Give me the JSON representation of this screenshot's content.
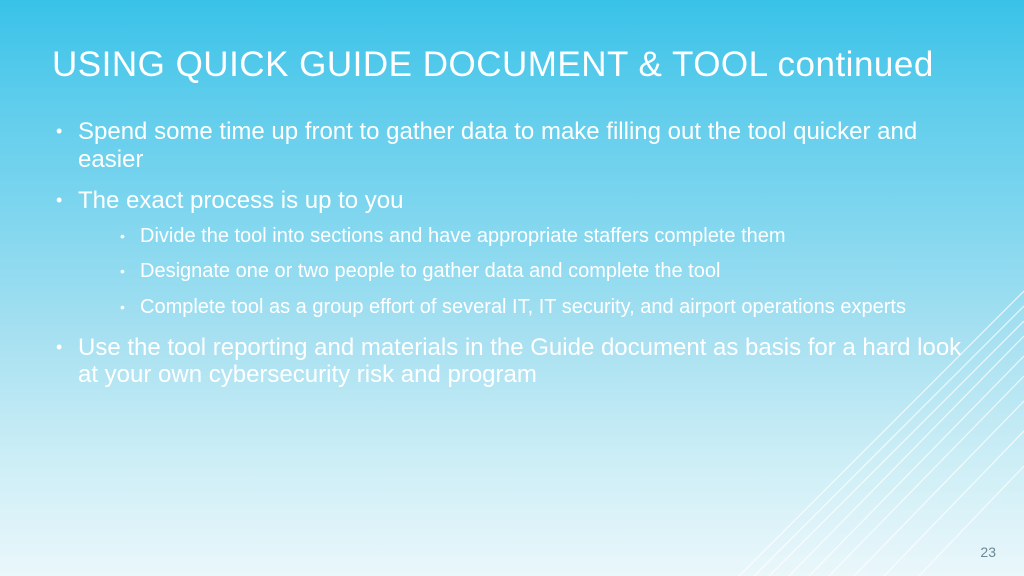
{
  "title": "USING QUICK GUIDE DOCUMENT & TOOL continued",
  "bullets": {
    "b1": "Spend some time up front to gather data to make filling out the tool quicker and easier",
    "b2": "The exact process is up to you",
    "sub1": "Divide the tool into sections and have appropriate staffers complete them",
    "sub2": "Designate one or two people to gather data and complete the tool",
    "sub3": "Complete tool as a group effort of several IT, IT security, and airport operations experts",
    "b3": "Use the tool reporting and materials in the Guide document as basis for a hard look at your own cybersecurity risk and program"
  },
  "page_number": "23"
}
